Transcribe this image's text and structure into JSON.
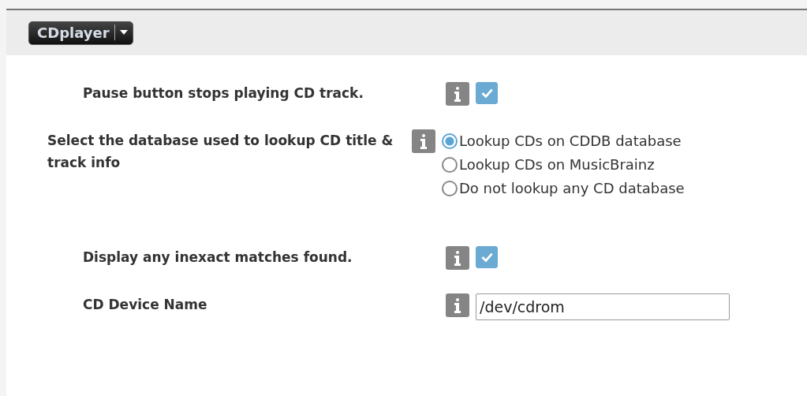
{
  "header": {
    "menu_button": {
      "label": "CDplayer"
    }
  },
  "settings": [
    {
      "kind": "checkbox",
      "label": "Pause button stops playing CD track.",
      "checked": true
    },
    {
      "kind": "radio",
      "label": "Select the database used to lookup CD title & track info",
      "options": [
        {
          "label": "Lookup CDs on CDDB database",
          "selected": true
        },
        {
          "label": "Lookup CDs on MusicBrainz",
          "selected": false
        },
        {
          "label": "Do not lookup any CD database",
          "selected": false
        }
      ]
    },
    {
      "kind": "checkbox",
      "label": "Display any inexact matches found.",
      "checked": true
    },
    {
      "kind": "text",
      "label": "CD Device Name",
      "value": "/dev/cdrom"
    }
  ]
}
